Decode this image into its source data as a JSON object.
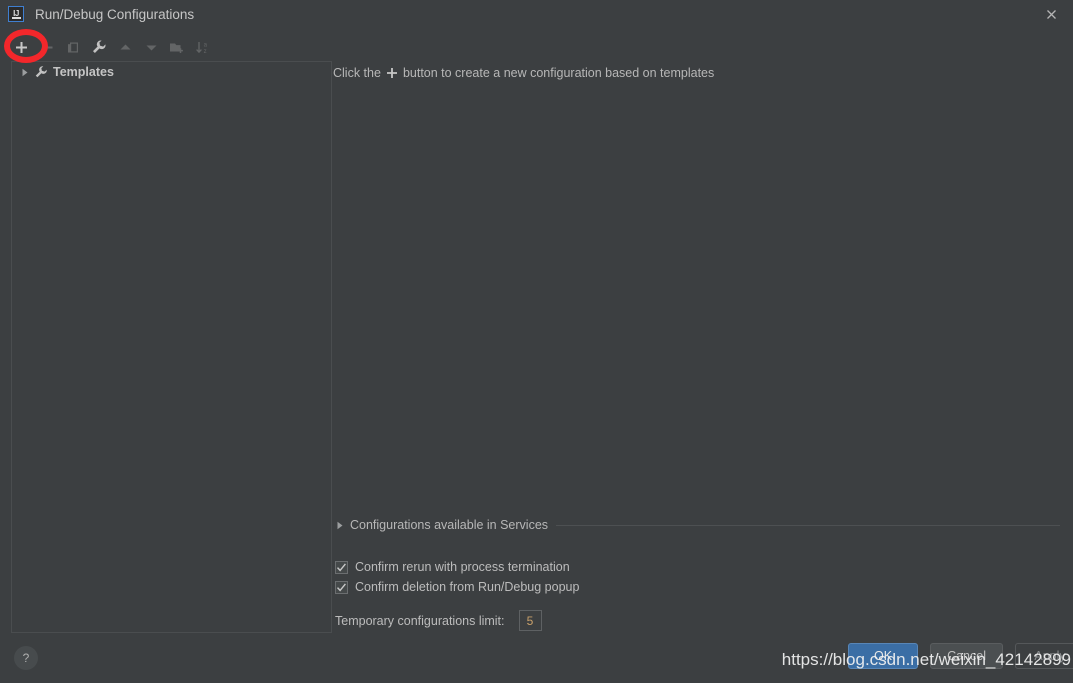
{
  "window": {
    "title": "Run/Debug Configurations",
    "app_icon": "intellij-idea-icon",
    "close_icon": "close-icon"
  },
  "toolbar": {
    "buttons": [
      {
        "name": "add-configuration-button",
        "icon": "plus-icon",
        "label": "+",
        "enabled": true
      },
      {
        "name": "remove-configuration-button",
        "icon": "minus-icon",
        "label": "−",
        "enabled": false
      },
      {
        "name": "copy-configuration-button",
        "icon": "copy-icon",
        "label": "Copy",
        "enabled": false
      },
      {
        "name": "edit-templates-button",
        "icon": "wrench-icon",
        "label": "Edit Templates",
        "enabled": true
      },
      {
        "name": "move-up-button",
        "icon": "arrow-up-icon",
        "label": "Move Up",
        "enabled": false
      },
      {
        "name": "move-down-button",
        "icon": "arrow-down-icon",
        "label": "Move Down",
        "enabled": false
      },
      {
        "name": "new-folder-button",
        "icon": "folder-add-icon",
        "label": "New Folder",
        "enabled": false
      },
      {
        "name": "sort-alphabetically-button",
        "icon": "sort-az-icon",
        "label": "Sort Configurations",
        "enabled": false
      }
    ]
  },
  "tree": {
    "items": [
      {
        "label": "Templates",
        "icon": "wrench-icon",
        "expand_icon": "triangle-right-icon",
        "expanded": false
      }
    ]
  },
  "content": {
    "hint_before": "Click the",
    "hint_icon": "plus-icon",
    "hint_after": "button to create a new configuration based on templates"
  },
  "services": {
    "label": "Configurations available in Services",
    "expand_icon": "triangle-right-icon",
    "expanded": false
  },
  "options": {
    "confirm_rerun": {
      "label": "Confirm rerun with process termination",
      "checked": true
    },
    "confirm_delete": {
      "label": "Confirm deletion from Run/Debug popup",
      "checked": true
    }
  },
  "temp_limit": {
    "label": "Temporary configurations limit:",
    "value": "5"
  },
  "help": {
    "icon": "question-mark-icon",
    "label": "?"
  },
  "dialog_buttons": {
    "ok": "OK",
    "cancel": "Cancel",
    "apply": "Apply"
  },
  "watermark": {
    "text": "https://blog.csdn.net/weixin_42142899"
  },
  "colors": {
    "background": "#3c3f41",
    "panel_border": "#4a4d4f",
    "text": "#bbbbbb",
    "accent_primary": "#3b6ea5",
    "annotation_red": "#f3272b",
    "input_value": "#c9a06a"
  }
}
